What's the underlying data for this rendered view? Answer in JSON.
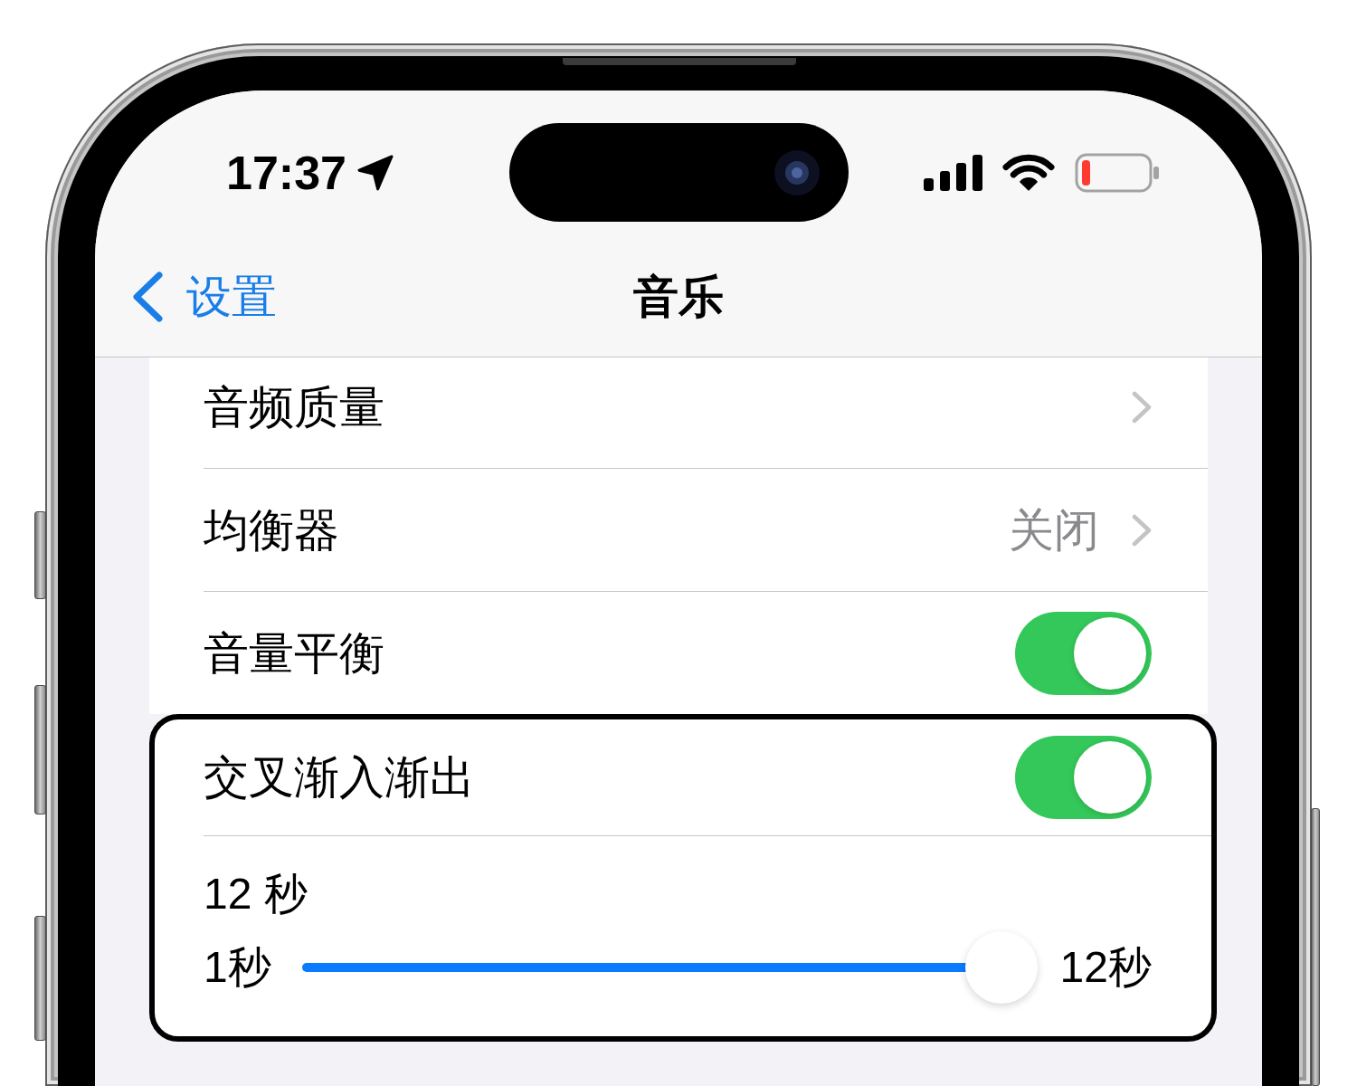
{
  "status_bar": {
    "time": "17:37"
  },
  "nav_bar": {
    "back": "设置",
    "title": "音乐"
  },
  "sections": [
    {
      "highlighted": false,
      "rows": [
        {
          "kind": "link",
          "label": "音频质量"
        },
        {
          "kind": "link",
          "label": "均衡器",
          "value": "关闭"
        },
        {
          "kind": "toggle",
          "label": "音量平衡",
          "on": true
        }
      ]
    },
    {
      "highlighted": true,
      "rows": [
        {
          "kind": "toggle",
          "label": "交叉渐入渐出",
          "on": true
        },
        {
          "kind": "slider",
          "label": "12 秒",
          "min_label": "1秒",
          "max_label": "12秒",
          "level": 1
        }
      ]
    }
  ]
}
